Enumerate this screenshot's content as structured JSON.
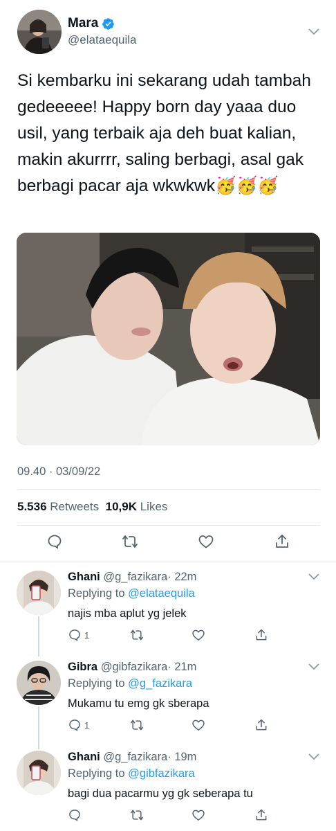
{
  "main_tweet": {
    "author_name": "Mara",
    "author_handle": "@elataequila",
    "text": "Si kembarku ini sekarang udah tambah gedeeeee! Happy born day yaaa duo usil, yang terbaik aja deh buat kalian, makin akurrrr, saling berbagi, asal gak berbagi pacar aja wkwkwk🥳🥳🥳",
    "timestamp": "09.40 · 03/09/22",
    "retweets_count": "5.536",
    "retweets_label": "Retweets",
    "likes_count": "10,9K",
    "likes_label": "Likes"
  },
  "replies": [
    {
      "name": "Ghani",
      "handle": "@g_fazikara",
      "time": "· 22m",
      "replying_prefix": "Replying to",
      "replying_to": "@elataequila",
      "text": "najis mba aplut yg jelek",
      "reply_count": "1"
    },
    {
      "name": "Gibra",
      "handle": "@gibfazikara",
      "time": "· 21m",
      "replying_prefix": "Replying to",
      "replying_to": "@g_fazikara",
      "text": "Mukamu tu emg gk sberapa",
      "reply_count": "1"
    },
    {
      "name": "Ghani",
      "handle": "@g_fazikara",
      "time": "· 19m",
      "replying_prefix": "Replying to",
      "replying_to": "@gibfazikara",
      "text": "bagi dua pacarmu yg gk seberapa tu",
      "reply_count": ""
    }
  ],
  "colors": {
    "accent": "#1d9bf0",
    "secondary_text": "#536471",
    "primary_text": "#0f1419",
    "divider": "#e1e6ea"
  },
  "icons": [
    "verified-badge-icon",
    "chevron-down-icon",
    "reply-icon",
    "retweet-icon",
    "like-icon",
    "share-icon"
  ]
}
